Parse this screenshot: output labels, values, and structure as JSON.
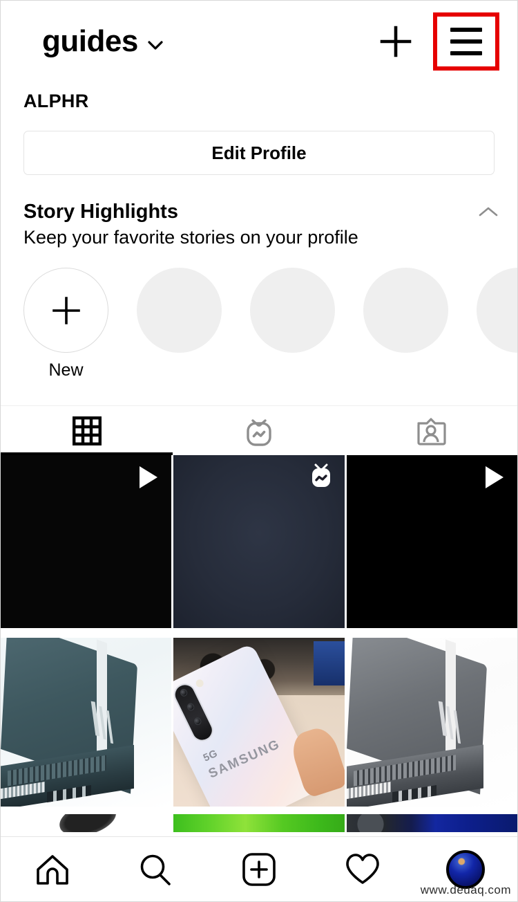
{
  "header": {
    "account_name": "guides",
    "account_switcher_icon": "chevron-down-icon",
    "add_icon": "plus-icon",
    "menu_icon": "hamburger-menu-icon",
    "menu_highlight_color": "#e60000"
  },
  "profile": {
    "display_name": "ALPHR",
    "edit_profile_label": "Edit Profile"
  },
  "story_highlights": {
    "title": "Story Highlights",
    "subtitle": "Keep your favorite stories on your profile",
    "collapse_icon": "chevron-up-icon",
    "items": [
      {
        "label": "New",
        "type": "new",
        "icon": "plus-icon"
      },
      {
        "label": "",
        "type": "placeholder"
      },
      {
        "label": "",
        "type": "placeholder"
      },
      {
        "label": "",
        "type": "placeholder"
      },
      {
        "label": "",
        "type": "placeholder"
      }
    ]
  },
  "tabs": [
    {
      "name": "grid",
      "icon": "grid-icon",
      "active": true
    },
    {
      "name": "igtv",
      "icon": "igtv-icon",
      "active": false
    },
    {
      "name": "tagged",
      "icon": "tagged-person-icon",
      "active": false
    }
  ],
  "media_grid": {
    "rows": [
      [
        {
          "kind": "video",
          "badge": "play-icon",
          "description": "dark video thumbnail"
        },
        {
          "kind": "igtv",
          "badge": "igtv-icon",
          "description": "dark navy igtv thumbnail"
        },
        {
          "kind": "video",
          "badge": "play-icon",
          "description": "black video thumbnail"
        }
      ],
      [
        {
          "kind": "photo",
          "badge": "",
          "description": "teal HP laptop"
        },
        {
          "kind": "photo",
          "badge": "",
          "description": "Samsung Galaxy S10 5G phone"
        },
        {
          "kind": "photo",
          "badge": "",
          "description": "grey HP laptop"
        }
      ],
      [
        {
          "kind": "photo",
          "badge": "",
          "description": "black computer mouse"
        },
        {
          "kind": "photo",
          "badge": "",
          "description": "green gradient"
        },
        {
          "kind": "photo",
          "badge": "",
          "description": "blue lit gaming PC"
        }
      ]
    ]
  },
  "bottom_nav": [
    {
      "name": "home",
      "icon": "home-icon"
    },
    {
      "name": "search",
      "icon": "search-icon"
    },
    {
      "name": "create",
      "icon": "plus-square-icon"
    },
    {
      "name": "activity",
      "icon": "heart-icon"
    },
    {
      "name": "profile",
      "icon": "avatar-icon"
    }
  ],
  "watermark": "www.deuaq.com"
}
